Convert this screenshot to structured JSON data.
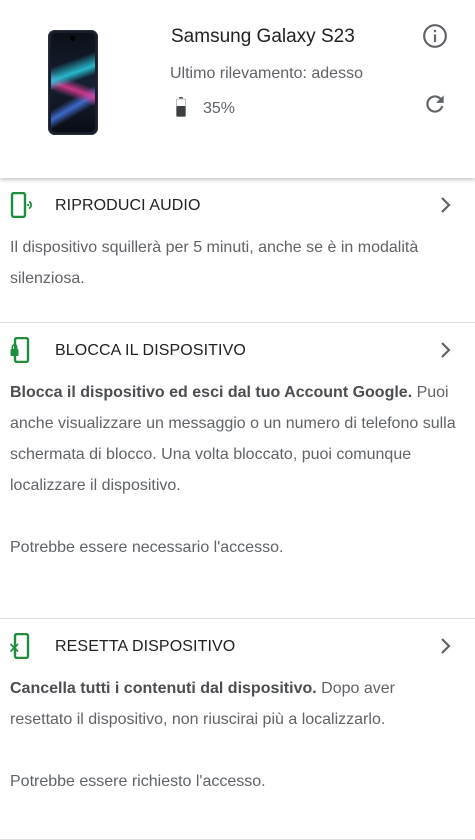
{
  "device": {
    "name": "Samsung Galaxy S23",
    "last_seen": "Ultimo rilevamento: adesso",
    "battery": "35%"
  },
  "header_actions": {
    "info_icon": "info-icon",
    "refresh_icon": "refresh-icon"
  },
  "colors": {
    "accent_green": "#1e8e3e",
    "text_primary": "#202124",
    "text_secondary": "#5f6368"
  },
  "actions": [
    {
      "title": "RIPRODUCI AUDIO",
      "icon": "phone-ring-icon",
      "body": "Il dispositivo squillerà per 5 minuti, anche se è in modalità silenziosa."
    },
    {
      "title": "BLOCCA IL DISPOSITIVO",
      "icon": "phone-lock-icon",
      "body_bold": "Blocca il dispositivo ed esci dal tuo Account Google.",
      "body": " Puoi anche visualizzare un messaggio o un numero di telefono sulla schermata di blocco. Una volta bloccato, puoi comunque localizzare il dispositivo.",
      "note": "Potrebbe essere necessario l'accesso."
    },
    {
      "title": "RESETTA DISPOSITIVO",
      "icon": "phone-erase-icon",
      "body_bold": "Cancella tutti i contenuti dal dispositivo.",
      "body": " Dopo aver resettato il dispositivo, non riuscirai più a localizzarlo.",
      "note": "Potrebbe essere richiesto l'accesso."
    }
  ]
}
